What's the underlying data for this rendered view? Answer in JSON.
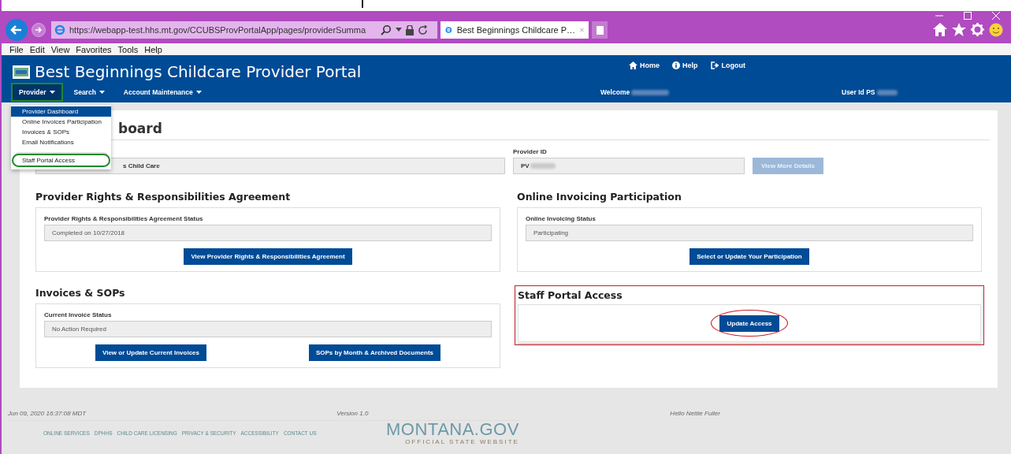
{
  "browser": {
    "address": "https://webapp-test.hhs.mt.gov/CCUBSProvPortalApp/pages/providerSumma",
    "tab_title": "Best Beginnings Childcare P…",
    "menu": [
      "File",
      "Edit",
      "View",
      "Favorites",
      "Tools",
      "Help"
    ]
  },
  "header": {
    "title": "Best Beginnings Childcare Provider Portal",
    "links": [
      {
        "label": "Home",
        "kind": "home"
      },
      {
        "label": "Help",
        "kind": "info"
      },
      {
        "label": "Logout",
        "kind": "logout"
      }
    ],
    "nav": [
      {
        "label": "Provider",
        "selected": true,
        "highlighted": true
      },
      {
        "label": "Search",
        "selected": false,
        "highlighted": false
      },
      {
        "label": "Account Maintenance",
        "selected": false,
        "highlighted": false
      }
    ],
    "welcome": "Welcome",
    "user_id": "User Id PS"
  },
  "dropdown": [
    {
      "label": "Provider Dashboard",
      "selected": true,
      "highlighted": false
    },
    {
      "label": "Online Invoices Participation",
      "selected": false,
      "highlighted": false
    },
    {
      "label": "Invoices & SOPs",
      "selected": false,
      "highlighted": false
    },
    {
      "label": "Email Notifications",
      "selected": false,
      "highlighted": false
    },
    {
      "label": "Staff Portal Access",
      "selected": false,
      "highlighted": true,
      "separated": true
    }
  ],
  "page": {
    "title": "board",
    "provider_name": "s Child Care",
    "provider_id_label": "Provider ID",
    "provider_id": "PV",
    "details_button": {
      "label": "View More Details",
      "disabled": true
    }
  },
  "sections": [
    {
      "title": "Provider Rights & Responsibilities Agreement",
      "kind": "status",
      "highlighted": false,
      "status_label": "Provider Rights & Responsibilities Agreement Status",
      "status_value": "Completed on 10/27/2018",
      "buttons": [
        {
          "label": "View Provider Rights & Responsibilities Agreement",
          "circled": false
        }
      ]
    },
    {
      "title": "Online Invoicing Participation",
      "kind": "status",
      "highlighted": false,
      "status_label": "Online Invoicing Status",
      "status_value": "Participating",
      "buttons": [
        {
          "label": "Select or Update Your Participation",
          "circled": false
        }
      ]
    },
    {
      "title": "Invoices & SOPs",
      "kind": "status",
      "highlighted": false,
      "status_label": "Current Invoice Status",
      "status_value": "No Action Required",
      "buttons": [
        {
          "label": "View or Update Current Invoices",
          "circled": false
        },
        {
          "label": "SOPs by Month & Archived Documents",
          "circled": false
        }
      ]
    },
    {
      "title": "Staff Portal Access",
      "kind": "action",
      "highlighted": true,
      "buttons": [
        {
          "label": "Update Access",
          "circled": true
        }
      ]
    }
  ],
  "footer": {
    "timestamp": "Jun 09, 2020 16:37:08 MDT",
    "version": "Version 1.0",
    "greeting": "Hello Nettie Fuller",
    "links": [
      "ONLINE SERVICES",
      "DPHHS",
      "CHILD CARE LICENSING",
      "PRIVACY & SECURITY",
      "ACCESSIBILITY",
      "CONTACT US"
    ],
    "logo": "MONTANA.GOV",
    "tagline": "OFFICIAL STATE WEBSITE"
  }
}
